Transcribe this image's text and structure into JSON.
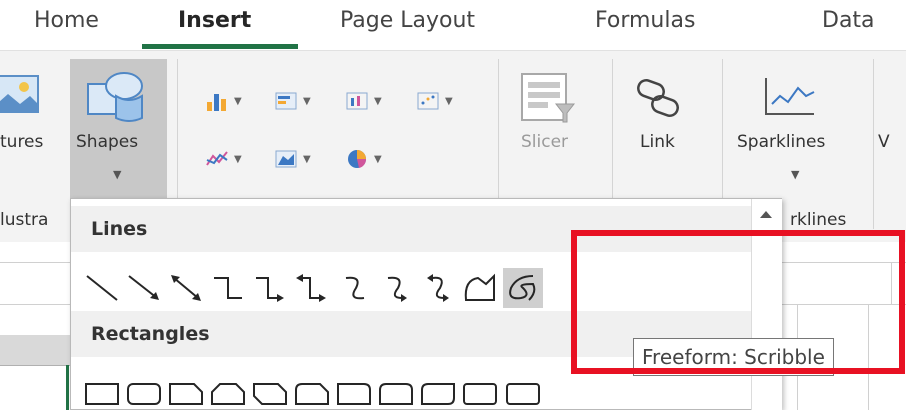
{
  "tabs": [
    {
      "label": "Home",
      "active": false
    },
    {
      "label": "Insert",
      "active": true
    },
    {
      "label": "Page Layout",
      "active": false
    },
    {
      "label": "Formulas",
      "active": false
    },
    {
      "label": "Data",
      "active": false
    }
  ],
  "ribbon": {
    "pictures_label": "tures",
    "shapes_label": "Shapes",
    "slicer_label": "Slicer",
    "link_label": "Link",
    "sparklines_label": "Sparklines",
    "cut_label": "V",
    "group_illustrations": "lustra",
    "group_sparklines": "rklines"
  },
  "gallery": {
    "lines_header": "Lines",
    "rectangles_header": "Rectangles",
    "line_shapes": [
      "line-icon",
      "arrow-line-icon",
      "double-arrow-line-icon",
      "elbow-connector-icon",
      "elbow-arrow-connector-icon",
      "elbow-double-arrow-connector-icon",
      "curved-connector-icon",
      "curved-arrow-connector-icon",
      "curved-double-arrow-connector-icon",
      "freeform-shape-icon",
      "freeform-scribble-icon"
    ],
    "selected": "freeform-scribble-icon"
  },
  "tooltip": {
    "text": "Freeform: Scribble"
  },
  "colors": {
    "accent": "#217346",
    "callout": "#e81123",
    "selection": "#cfcfcf"
  }
}
